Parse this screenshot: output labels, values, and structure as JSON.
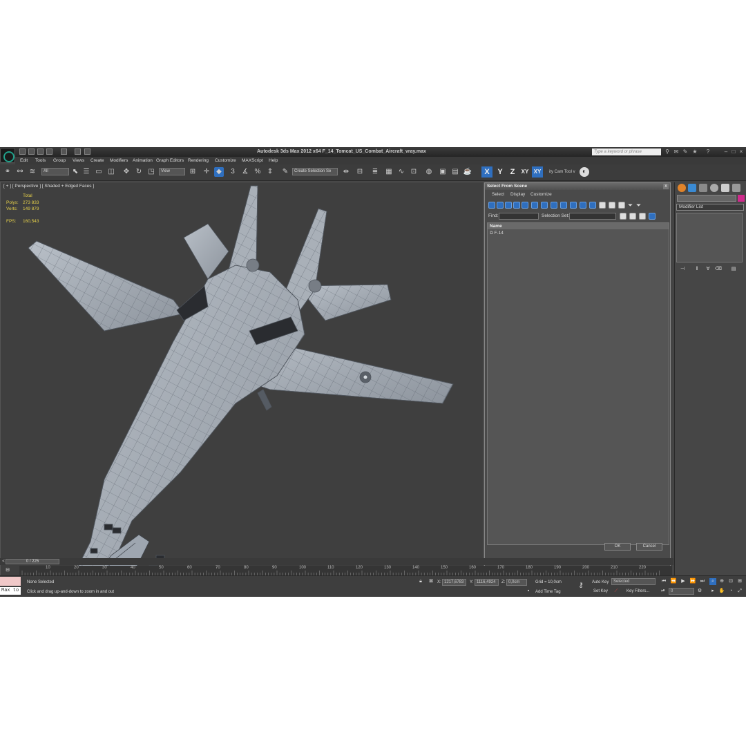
{
  "app": {
    "title": "Autodesk 3ds Max  2012 x64     F_14_Tomcat_US_Combat_Aircraft_vray.max",
    "search_placeholder": "Type a keyword or phrase"
  },
  "menu": [
    "Edit",
    "Tools",
    "Group",
    "Views",
    "Create",
    "Modifiers",
    "Animation",
    "Graph Editors",
    "Rendering",
    "Customize",
    "MAXScript",
    "Help"
  ],
  "toolbar": {
    "filter_value": "All",
    "coord_value": "View",
    "selection_set": "Create Selection Se",
    "axes": [
      "X",
      "Y",
      "Z",
      "XY",
      "XY"
    ],
    "tool_label": "ity Cam Tool v"
  },
  "viewport": {
    "label": "[ + ] [ Perspective ] [ Shaded + Edged Faces ]",
    "stats_total": "Total",
    "polys_label": "Polys:",
    "polys_value": "273 833",
    "verts_label": "Verts:",
    "verts_value": "149 879",
    "fps_label": "FPS:",
    "fps_value": "160,543"
  },
  "dialog": {
    "title": "Select From Scene",
    "close": "x",
    "menu": [
      "Select",
      "Display",
      "Customize"
    ],
    "find_label": "Find:",
    "selection_set_label": "Selection Set:",
    "list_header": "Name",
    "items": [
      "F-14"
    ],
    "ok": "OK",
    "cancel": "Cancel"
  },
  "command_panel": {
    "modifier_list": "Modifier List"
  },
  "timeline": {
    "frame": "0 / 225",
    "ticks": [
      "10",
      "20",
      "30",
      "40",
      "50",
      "60",
      "70",
      "80",
      "90",
      "100",
      "110",
      "120",
      "130",
      "140",
      "150",
      "160",
      "170",
      "180",
      "190",
      "200",
      "210",
      "220"
    ]
  },
  "status": {
    "selection": "None Selected",
    "prompt": "Click and drag up-and-down to zoom in and out",
    "x_label": "X:",
    "x_value": "1217,6783",
    "y_label": "Y:",
    "y_value": "1116,4924",
    "z_label": "Z:",
    "z_value": "0,0cm",
    "grid": "Grid = 10,0cm",
    "add_time_tag": "Add Time Tag",
    "auto_key": "Auto Key",
    "set_key": "Set Key",
    "key_mode": "Selected",
    "key_filters": "Key Filters...",
    "frame_value": "0",
    "maxscript": "Max to"
  },
  "colors": {
    "accent": "#2f6fbf",
    "viewport_bg": "#3f3f3f",
    "stats": "#e6d14a",
    "modifier_color": "#d02a8c"
  }
}
